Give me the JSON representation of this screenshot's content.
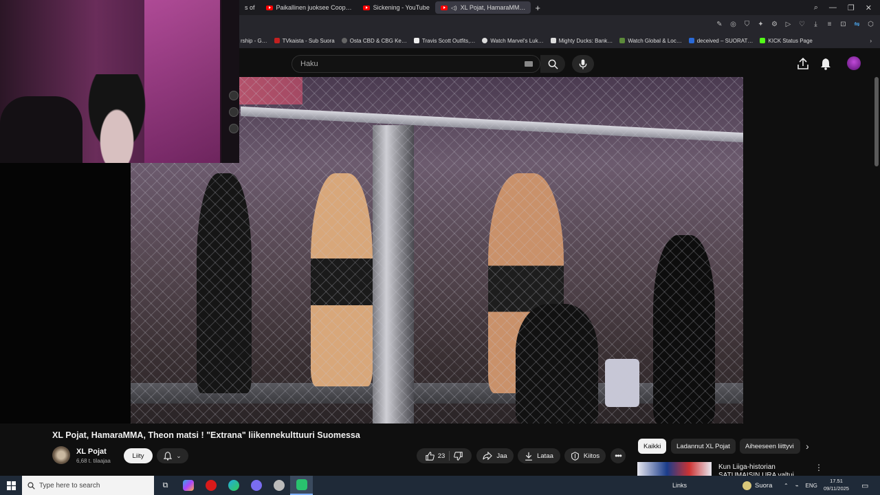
{
  "browser": {
    "tabs": [
      {
        "label": "s of",
        "icon": "none"
      },
      {
        "label": "Paikallinen juoksee Coop…",
        "icon": "youtube-icon"
      },
      {
        "label": "Sickening - YouTube",
        "icon": "youtube-icon"
      },
      {
        "label": "XL Pojat, HamaraMM…",
        "icon": "youtube-icon",
        "active": true
      }
    ],
    "new_tab": "+",
    "bookmarks": [
      {
        "label": "rship - G…",
        "color": "#444"
      },
      {
        "label": "TVkaista - Sub Suora",
        "color": "#c32020"
      },
      {
        "label": "Osta CBD & CBG Ke…",
        "color": "#666"
      },
      {
        "label": "Travis Scott Outfits,…",
        "color": "#eee"
      },
      {
        "label": "Watch Marvel's Luk…",
        "color": "#ddd"
      },
      {
        "label": "Mighty Ducks: Bank…",
        "color": "#ddd"
      },
      {
        "label": "Watch Global & Loc…",
        "color": "#5c8a3a"
      },
      {
        "label": "deceived – SUORAT…",
        "color": "#2a6ad8"
      },
      {
        "label": "KICK Status Page",
        "color": "#53fc18"
      }
    ],
    "bookmarks_more": "›"
  },
  "youtube": {
    "search_placeholder": "Haku",
    "video": {
      "title": "XL Pojat, HamaraMMA, Theon matsi ! \"Extrana\" liikennekulttuuri Suomessa",
      "channel": "XL Pojat",
      "subscribers": "6,68 t. tilaajaa",
      "join_label": "Liity",
      "likes": "23",
      "share_label": "Jaa",
      "download_label": "Lataa",
      "thanks_label": "Kiitos"
    },
    "chips": [
      "Kaikki",
      "Ladannut XL Pojat",
      "Aiheeseen liittyvi"
    ],
    "recommendation": {
      "title": "Kun Liiga-historian SATUMAISIN URA valtui…"
    }
  },
  "taskbar": {
    "search_placeholder": "Type here to search",
    "links_label": "Links",
    "weather_label": "Suora",
    "lang": "ENG",
    "time": "17.51",
    "date": "09/11/2025"
  }
}
